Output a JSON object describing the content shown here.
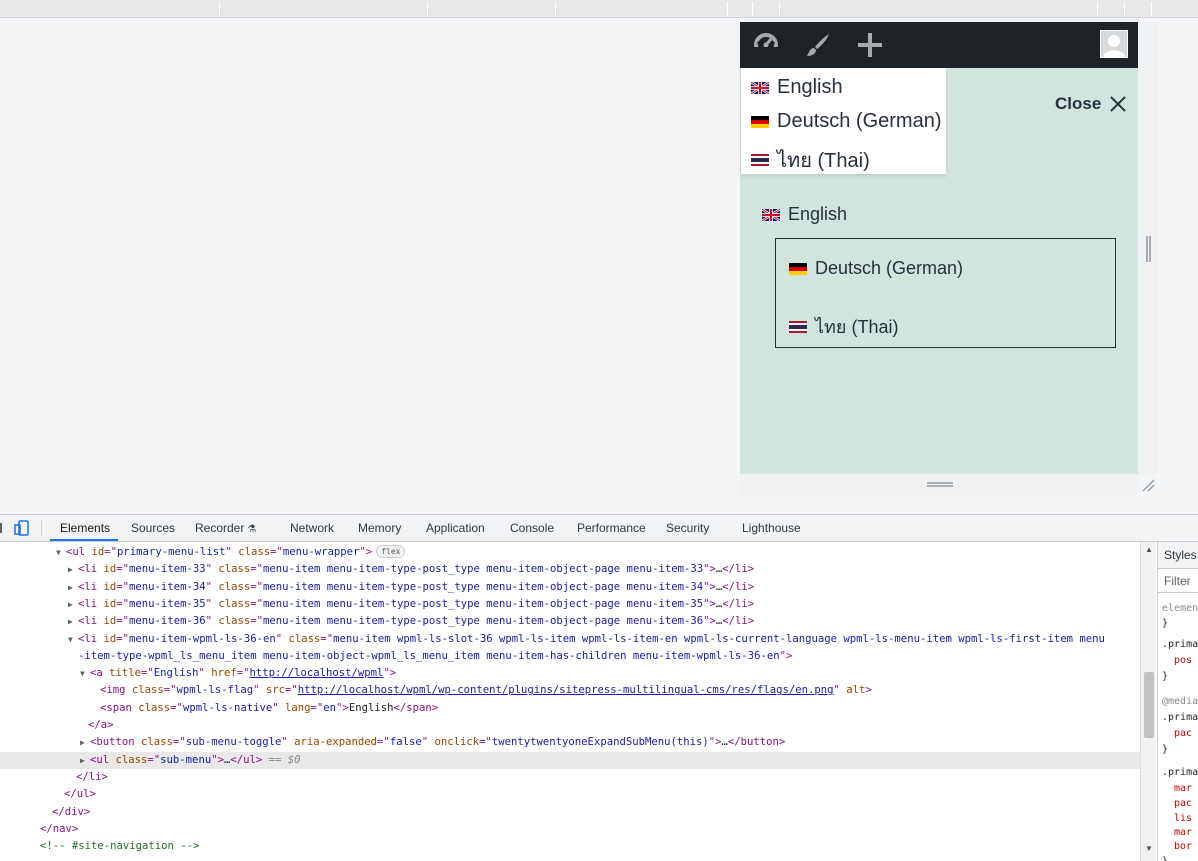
{
  "admin_bar": {
    "icons": [
      "dashboard-icon",
      "customize-brush-icon",
      "new-content-plus-icon",
      "user-avatar-icon"
    ]
  },
  "language_dropdown": {
    "items": [
      {
        "flag": "en",
        "label": "English"
      },
      {
        "flag": "de",
        "label": "Deutsch (German)"
      },
      {
        "flag": "th",
        "label": "ไทย (Thai)"
      }
    ]
  },
  "menu_panel": {
    "close_label": "Close",
    "current_language": {
      "flag": "en",
      "label": "English"
    },
    "sub_menu": [
      {
        "flag": "de",
        "label": "Deutsch (German)"
      },
      {
        "flag": "th",
        "label": "ไทย (Thai)"
      }
    ]
  },
  "devtools": {
    "tabs": [
      "Elements",
      "Sources",
      "Recorder",
      "Network",
      "Memory",
      "Application",
      "Console",
      "Performance",
      "Security",
      "Lighthouse"
    ],
    "active_tab": "Elements",
    "dom_lines": [
      {
        "tri": "▼",
        "segments": [
          [
            "tag",
            "<ul "
          ],
          [
            "attr",
            "id"
          ],
          [
            "tag",
            "=\""
          ],
          [
            "val",
            "primary-menu-list"
          ],
          [
            "tag",
            "\" "
          ],
          [
            "attr",
            "class"
          ],
          [
            "tag",
            "=\""
          ],
          [
            "val",
            "menu-wrapper"
          ],
          [
            "tag",
            "\">"
          ]
        ],
        "badge": "flex"
      },
      {
        "tri": "▶",
        "segments": [
          [
            "tag",
            "<li "
          ],
          [
            "attr",
            "id"
          ],
          [
            "tag",
            "=\""
          ],
          [
            "val",
            "menu-item-33"
          ],
          [
            "tag",
            "\" "
          ],
          [
            "attr",
            "class"
          ],
          [
            "tag",
            "=\""
          ],
          [
            "val",
            "menu-item menu-item-type-post_type menu-item-object-page menu-item-33"
          ],
          [
            "tag",
            "\">"
          ],
          [
            "txt",
            "…"
          ],
          [
            "tag",
            "</li>"
          ]
        ]
      },
      {
        "tri": "▶",
        "segments": [
          [
            "tag",
            "<li "
          ],
          [
            "attr",
            "id"
          ],
          [
            "tag",
            "=\""
          ],
          [
            "val",
            "menu-item-34"
          ],
          [
            "tag",
            "\" "
          ],
          [
            "attr",
            "class"
          ],
          [
            "tag",
            "=\""
          ],
          [
            "val",
            "menu-item menu-item-type-post_type menu-item-object-page menu-item-34"
          ],
          [
            "tag",
            "\">"
          ],
          [
            "txt",
            "…"
          ],
          [
            "tag",
            "</li>"
          ]
        ]
      },
      {
        "tri": "▶",
        "segments": [
          [
            "tag",
            "<li "
          ],
          [
            "attr",
            "id"
          ],
          [
            "tag",
            "=\""
          ],
          [
            "val",
            "menu-item-35"
          ],
          [
            "tag",
            "\" "
          ],
          [
            "attr",
            "class"
          ],
          [
            "tag",
            "=\""
          ],
          [
            "val",
            "menu-item menu-item-type-post_type menu-item-object-page menu-item-35"
          ],
          [
            "tag",
            "\">"
          ],
          [
            "txt",
            "…"
          ],
          [
            "tag",
            "</li>"
          ]
        ]
      },
      {
        "tri": "▶",
        "segments": [
          [
            "tag",
            "<li "
          ],
          [
            "attr",
            "id"
          ],
          [
            "tag",
            "=\""
          ],
          [
            "val",
            "menu-item-36"
          ],
          [
            "tag",
            "\" "
          ],
          [
            "attr",
            "class"
          ],
          [
            "tag",
            "=\""
          ],
          [
            "val",
            "menu-item menu-item-type-post_type menu-item-object-page menu-item-36"
          ],
          [
            "tag",
            "\">"
          ],
          [
            "txt",
            "…"
          ],
          [
            "tag",
            "</li>"
          ]
        ]
      },
      {
        "tri": "▼",
        "segments": [
          [
            "tag",
            "<li "
          ],
          [
            "attr",
            "id"
          ],
          [
            "tag",
            "=\""
          ],
          [
            "val",
            "menu-item-wpml-ls-36-en"
          ],
          [
            "tag",
            "\" "
          ],
          [
            "attr",
            "class"
          ],
          [
            "tag",
            "=\""
          ],
          [
            "val",
            "menu-item wpml-ls-slot-36 wpml-ls-item wpml-ls-item-en wpml-ls-current-language wpml-ls-menu-item wpml-ls-first-item menu"
          ]
        ]
      },
      {
        "tri": "",
        "segments": [
          [
            "val",
            "-item-type-wpml_ls_menu_item menu-item-object-wpml_ls_menu_item menu-item-has-children menu-item-wpml-ls-36-en"
          ],
          [
            "tag",
            "\">"
          ]
        ]
      },
      {
        "tri": "▼",
        "segments": [
          [
            "tag",
            "<a "
          ],
          [
            "attr",
            "title"
          ],
          [
            "tag",
            "=\""
          ],
          [
            "val",
            "English"
          ],
          [
            "tag",
            "\" "
          ],
          [
            "attr",
            "href"
          ],
          [
            "tag",
            "=\""
          ],
          [
            "link",
            "http://localhost/wpml"
          ],
          [
            "tag",
            "\">"
          ]
        ]
      },
      {
        "tri": "",
        "segments": [
          [
            "tag",
            "<img "
          ],
          [
            "attr",
            "class"
          ],
          [
            "tag",
            "=\""
          ],
          [
            "val",
            "wpml-ls-flag"
          ],
          [
            "tag",
            "\" "
          ],
          [
            "attr",
            "src"
          ],
          [
            "tag",
            "=\""
          ],
          [
            "link",
            "http://localhost/wpml/wp-content/plugins/sitepress-multilingual-cms/res/flags/en.png"
          ],
          [
            "tag",
            "\" "
          ],
          [
            "attr",
            "alt"
          ],
          [
            "tag",
            ">"
          ]
        ]
      },
      {
        "tri": "",
        "segments": [
          [
            "tag",
            "<span "
          ],
          [
            "attr",
            "class"
          ],
          [
            "tag",
            "=\""
          ],
          [
            "val",
            "wpml-ls-native"
          ],
          [
            "tag",
            "\" "
          ],
          [
            "attr",
            "lang"
          ],
          [
            "tag",
            "=\""
          ],
          [
            "val",
            "en"
          ],
          [
            "tag",
            "\">"
          ],
          [
            "txt",
            "English"
          ],
          [
            "tag",
            "</span>"
          ]
        ]
      },
      {
        "tri": "",
        "segments": [
          [
            "tag",
            "</a>"
          ]
        ]
      },
      {
        "tri": "▶",
        "segments": [
          [
            "tag",
            "<button "
          ],
          [
            "attr",
            "class"
          ],
          [
            "tag",
            "=\""
          ],
          [
            "val",
            "sub-menu-toggle"
          ],
          [
            "tag",
            "\" "
          ],
          [
            "attr",
            "aria-expanded"
          ],
          [
            "tag",
            "=\""
          ],
          [
            "val",
            "false"
          ],
          [
            "tag",
            "\" "
          ],
          [
            "attr",
            "onclick"
          ],
          [
            "tag",
            "=\""
          ],
          [
            "val",
            "twentytwentyoneExpandSubMenu(this)"
          ],
          [
            "tag",
            "\">"
          ],
          [
            "txt",
            "…"
          ],
          [
            "tag",
            "</button>"
          ]
        ]
      },
      {
        "tri": "▶",
        "segments": [
          [
            "tag",
            "<ul "
          ],
          [
            "attr",
            "class"
          ],
          [
            "tag",
            "=\""
          ],
          [
            "val",
            "sub-menu"
          ],
          [
            "tag",
            "\">"
          ],
          [
            "txt",
            "…"
          ],
          [
            "tag",
            "</ul>"
          ],
          [
            "sel",
            " == $0"
          ]
        ],
        "selected": true
      },
      {
        "tri": "",
        "segments": [
          [
            "tag",
            "</li>"
          ]
        ]
      },
      {
        "tri": "",
        "segments": [
          [
            "tag",
            "</ul>"
          ]
        ]
      },
      {
        "tri": "",
        "segments": [
          [
            "tag",
            "</div>"
          ]
        ]
      },
      {
        "tri": "",
        "segments": [
          [
            "tag",
            "</nav>"
          ]
        ]
      },
      {
        "tri": "",
        "segments": [
          [
            "com",
            "<!-- #site-navigation -->"
          ]
        ]
      }
    ],
    "styles_panel": {
      "tab_label": "Styles",
      "filter_placeholder": "Filter",
      "rows": [
        "elemen",
        "}",
        ".prima",
        "pos",
        "}",
        "@media",
        ".prima",
        "pac",
        "}",
        ".prima",
        "mar",
        "pac",
        "lis",
        "mar",
        "bor",
        "}"
      ]
    }
  }
}
